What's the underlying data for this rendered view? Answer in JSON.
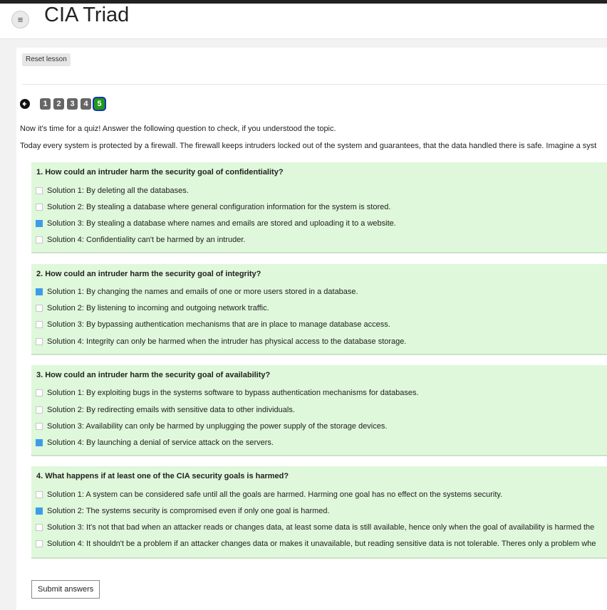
{
  "header": {
    "title": "CIA Triad",
    "menu_icon": "≡"
  },
  "toolbar": {
    "reset_label": "Reset lesson"
  },
  "navigation": {
    "prev_icon": "🡐",
    "steps": [
      "1",
      "2",
      "3",
      "4",
      "5"
    ],
    "current_step": "5"
  },
  "intro": {
    "line1": "Now it's time for a quiz! Answer the following question to check, if you understood the topic.",
    "line2": "Today every system is protected by a firewall. The firewall keeps intruders locked out of the system and guarantees, that the data handled there is safe. Imagine a syst"
  },
  "questions": [
    {
      "title": "1. How could an intruder harm the security goal of confidentiality?",
      "options": [
        {
          "label": "Solution 1: By deleting all the databases.",
          "checked": false
        },
        {
          "label": "Solution 2: By stealing a database where general configuration information for the system is stored.",
          "checked": false
        },
        {
          "label": "Solution 3: By stealing a database where names and emails are stored and uploading it to a website.",
          "checked": true
        },
        {
          "label": "Solution 4: Confidentiality can't be harmed by an intruder.",
          "checked": false
        }
      ]
    },
    {
      "title": "2. How could an intruder harm the security goal of integrity?",
      "options": [
        {
          "label": "Solution 1: By changing the names and emails of one or more users stored in a database.",
          "checked": true
        },
        {
          "label": "Solution 2: By listening to incoming and outgoing network traffic.",
          "checked": false
        },
        {
          "label": "Solution 3: By bypassing authentication mechanisms that are in place to manage database access.",
          "checked": false
        },
        {
          "label": "Solution 4: Integrity can only be harmed when the intruder has physical access to the database storage.",
          "checked": false
        }
      ]
    },
    {
      "title": "3. How could an intruder harm the security goal of availability?",
      "options": [
        {
          "label": "Solution 1: By exploiting bugs in the systems software to bypass authentication mechanisms for databases.",
          "checked": false
        },
        {
          "label": "Solution 2: By redirecting emails with sensitive data to other individuals.",
          "checked": false
        },
        {
          "label": "Solution 3: Availability can only be harmed by unplugging the power supply of the storage devices.",
          "checked": false
        },
        {
          "label": "Solution 4: By launching a denial of service attack on the servers.",
          "checked": true
        }
      ]
    },
    {
      "title": "4. What happens if at least one of the CIA security goals is harmed?",
      "options": [
        {
          "label": "Solution 1: A system can be considered safe until all the goals are harmed. Harming one goal has no effect on the systems security.",
          "checked": false
        },
        {
          "label": "Solution 2: The systems security is compromised even if only one goal is harmed.",
          "checked": true
        },
        {
          "label": "Solution 3: It's not that bad when an attacker reads or changes data, at least some data is still available, hence only when the goal of availability is harmed the",
          "checked": false
        },
        {
          "label": "Solution 4: It shouldn't be a problem if an attacker changes data or makes it unavailable, but reading sensitive data is not tolerable. Theres only a problem whe",
          "checked": false
        }
      ]
    }
  ],
  "footer": {
    "submit_label": "Submit answers"
  },
  "colors": {
    "accent": "#3d9be9",
    "question_bg": "#dff7da",
    "current_step": "#1e9b14"
  }
}
